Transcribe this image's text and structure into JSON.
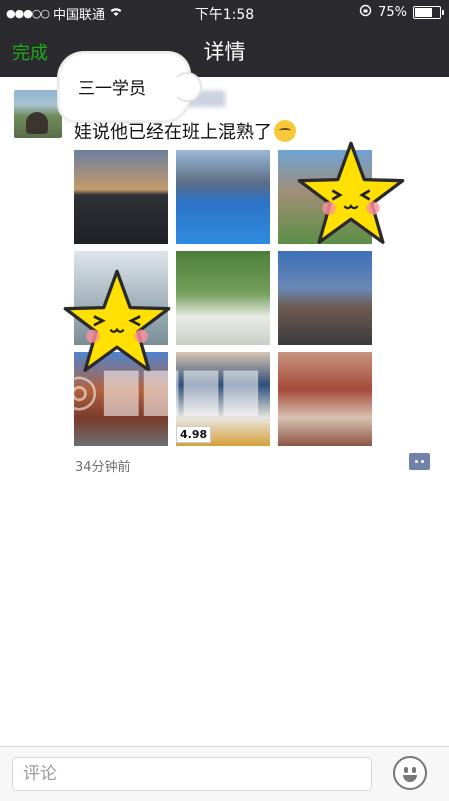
{
  "status_bar": {
    "signal": "●●●○○",
    "carrier": "中国联通",
    "wifi_icon": "wifi-icon",
    "time": "下午1:58",
    "lock_icon": "rotation-lock-icon",
    "battery_percent": "75%",
    "battery_level": 0.75
  },
  "nav": {
    "done_label": "完成",
    "title": "详情"
  },
  "post": {
    "sticker_label": "三一学员",
    "author": "▇▇▇▇",
    "text": "娃说他已经在班上混熟了",
    "emoji": "smirk-face-icon",
    "timestamp": "34分钟前",
    "price_label": "4.98",
    "watermark": "◎▇▇▇▇"
  },
  "comment": {
    "placeholder": "评论"
  },
  "colors": {
    "bar": "#2b2b2f",
    "accent": "#1aad19",
    "star": "#ffe000"
  }
}
